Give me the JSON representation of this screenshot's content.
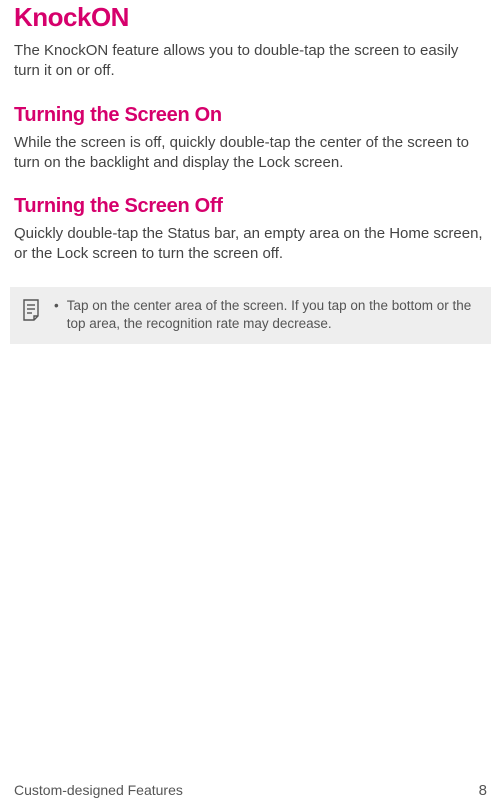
{
  "title": "KnockON",
  "intro": "The KnockON feature allows you to double-tap the screen to easily turn it on or off.",
  "sections": [
    {
      "heading": "Turning the Screen On",
      "body": "While the screen is off, quickly double-tap the center of the screen to turn on the backlight and display the Lock screen."
    },
    {
      "heading": "Turning the Screen Off",
      "body": "Quickly double-tap the Status bar, an empty area on the Home screen, or the Lock screen to turn the screen off."
    }
  ],
  "note": {
    "bullet": "•",
    "text": "Tap on the center area of the screen. If you tap on the bottom or the top area, the recognition rate may decrease."
  },
  "footer": {
    "left": "Custom-designed Features",
    "right": "8"
  }
}
